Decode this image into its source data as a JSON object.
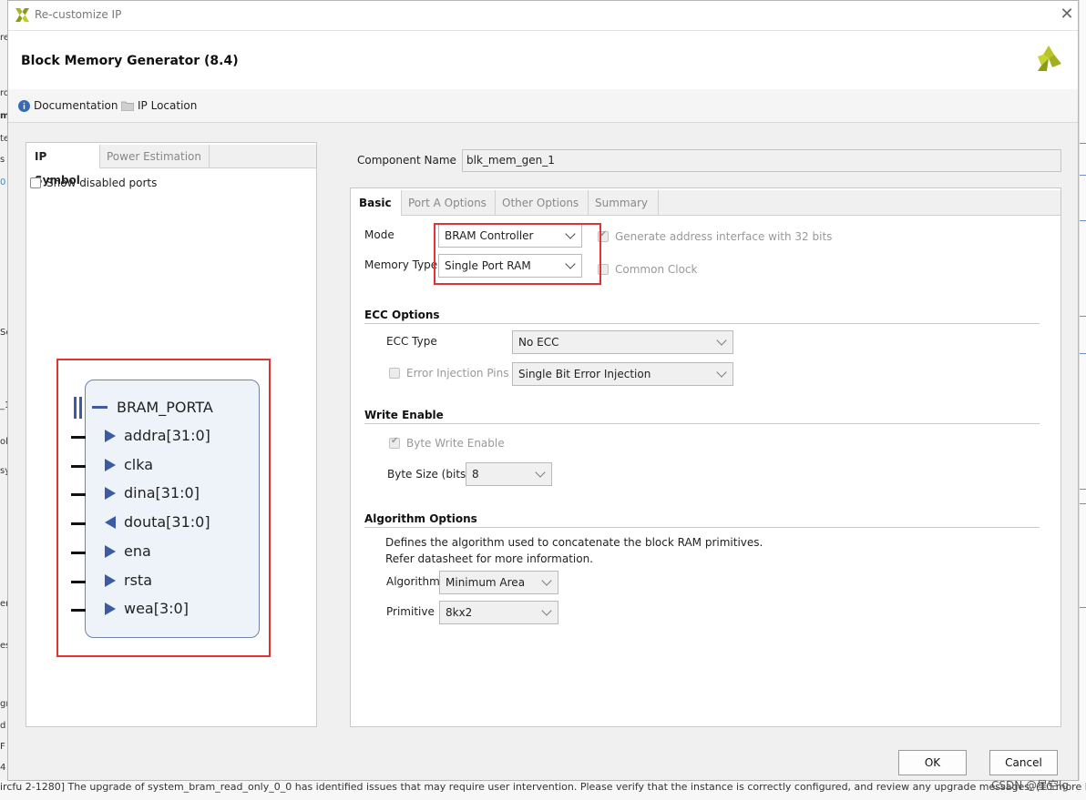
{
  "window": {
    "title": "Re-customize IP",
    "close_glyph": "✕"
  },
  "header": {
    "heading": "Block Memory Generator (8.4)"
  },
  "links": {
    "documentation": "Documentation",
    "ip_location": "IP Location"
  },
  "background": {
    "left_fragments": [
      "re",
      "ro",
      "m",
      "te",
      "s",
      "0",
      "Sc",
      "_1",
      "ol",
      "sy",
      "en",
      "es",
      "gn",
      "d I",
      "F",
      "4"
    ],
    "status_message": "ircfu 2-1280] The upgrade of system_bram_read_only_0_0 has identified issues that may require user intervention. Please verify that the instance is correctly configured, and review any upgrade messages. (10 more like",
    "watermark": "CSDN @星空lg"
  },
  "left_panel": {
    "tabs": [
      "IP Symbol",
      "Power Estimation"
    ],
    "show_disabled_ports": {
      "label": "Show disabled ports",
      "checked": false
    },
    "symbol": {
      "bus_name": "BRAM_PORTA",
      "ports": [
        {
          "name": "addra[31:0]",
          "dir": "in"
        },
        {
          "name": "clka",
          "dir": "in"
        },
        {
          "name": "dina[31:0]",
          "dir": "in"
        },
        {
          "name": "douta[31:0]",
          "dir": "out"
        },
        {
          "name": "ena",
          "dir": "in"
        },
        {
          "name": "rsta",
          "dir": "in"
        },
        {
          "name": "wea[3:0]",
          "dir": "in"
        }
      ]
    }
  },
  "component": {
    "label": "Component Name",
    "value": "blk_mem_gen_1"
  },
  "tabs": [
    "Basic",
    "Port A Options",
    "Other Options",
    "Summary"
  ],
  "basic": {
    "mode_label": "Mode",
    "mode_value": "BRAM Controller",
    "memory_type_label": "Memory Type",
    "memory_type_value": "Single Port RAM",
    "gen_addr_label": "Generate address interface with 32 bits",
    "common_clock_label": "Common Clock",
    "ecc": {
      "title": "ECC Options",
      "type_label": "ECC Type",
      "type_value": "No ECC",
      "error_injection_label": "Error Injection Pins",
      "error_injection_value": "Single Bit Error Injection"
    },
    "write_enable": {
      "title": "Write Enable",
      "byte_write_label": "Byte Write Enable",
      "byte_size_label": "Byte Size (bits)",
      "byte_size_value": "8"
    },
    "algorithm": {
      "title": "Algorithm Options",
      "desc1": "Defines the algorithm used to concatenate the block RAM primitives.",
      "desc2": "Refer datasheet for more information.",
      "algorithm_label": "Algorithm",
      "algorithm_value": "Minimum Area",
      "primitive_label": "Primitive",
      "primitive_value": "8kx2"
    }
  },
  "buttons": {
    "ok": "OK",
    "cancel": "Cancel"
  },
  "colors": {
    "highlight_red": "#e03333",
    "symbol_fill": "#eef3fa",
    "port_arrow": "#3b5ba3",
    "xilinx_logo": "#a8b520"
  }
}
